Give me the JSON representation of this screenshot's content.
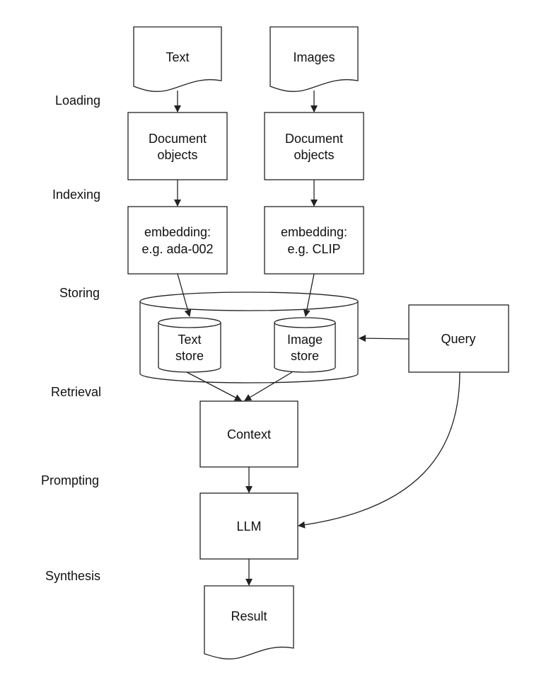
{
  "stages": [
    "Loading",
    "Indexing",
    "Storing",
    "Retrieval",
    "Prompting",
    "Synthesis"
  ],
  "nodes": {
    "text_source": "Text",
    "images_source": "Images",
    "text_docs": [
      "Document",
      "objects"
    ],
    "image_docs": [
      "Document",
      "objects"
    ],
    "text_embedding": [
      "embedding:",
      "e.g. ada-002"
    ],
    "image_embedding": [
      "embedding:",
      "e.g. CLIP"
    ],
    "text_store": [
      "Text",
      "store"
    ],
    "image_store": [
      "Image",
      "store"
    ],
    "query": "Query",
    "context": "Context",
    "llm": "LLM",
    "result": "Result"
  }
}
